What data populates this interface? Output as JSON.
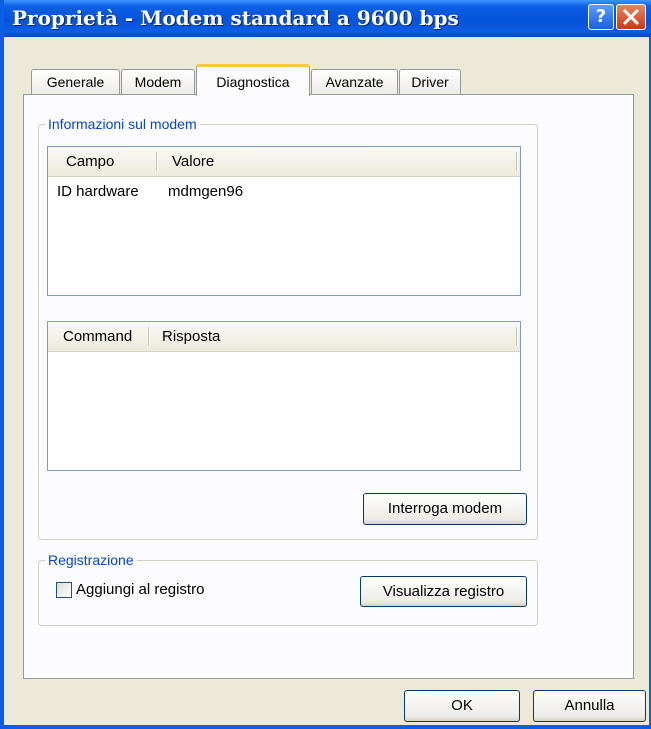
{
  "window": {
    "title": "Proprietà - Modem standard a 9600 bps",
    "help_label": "?",
    "close_icon": "close-icon"
  },
  "tabs": [
    {
      "label": "Generale",
      "active": false
    },
    {
      "label": "Modem",
      "active": false
    },
    {
      "label": "Diagnostica",
      "active": true
    },
    {
      "label": "Avanzate",
      "active": false
    },
    {
      "label": "Driver",
      "active": false
    }
  ],
  "modem_info": {
    "group_title": "Informazioni sul modem",
    "table1": {
      "columns": [
        "Campo",
        "Valore"
      ],
      "rows": [
        [
          "ID hardware",
          "mdmgen96"
        ]
      ]
    },
    "table2": {
      "columns": [
        "Command",
        "Risposta"
      ],
      "rows": []
    },
    "query_button": "Interroga modem"
  },
  "logging": {
    "group_title": "Registrazione",
    "checkbox_label": "Aggiungi al registro",
    "checkbox_checked": false,
    "view_log_button": "Visualizza registro"
  },
  "footer": {
    "ok_label": "OK",
    "cancel_label": "Annulla"
  }
}
